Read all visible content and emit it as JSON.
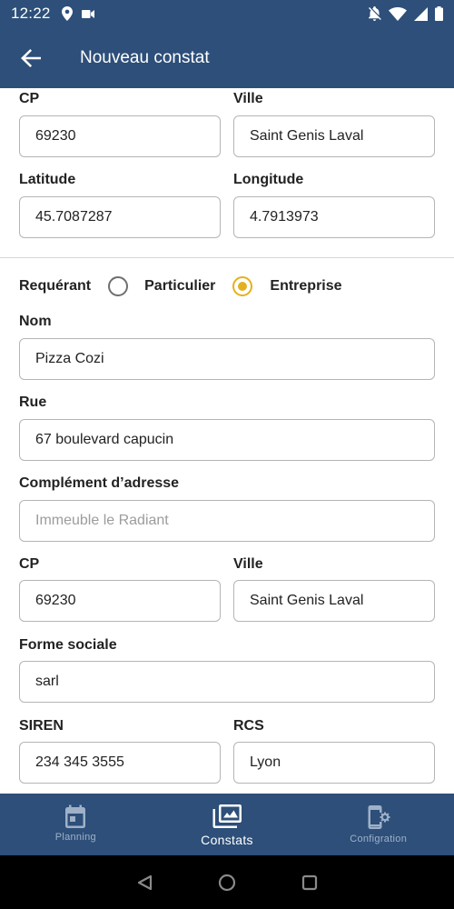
{
  "status_bar": {
    "time": "12:22",
    "left_icons": [
      "location-icon",
      "video-camera-icon"
    ],
    "right_icons": [
      "notifications-off-icon",
      "wifi-icon",
      "signal-icon",
      "battery-icon"
    ]
  },
  "app_bar": {
    "title": "Nouveau constat"
  },
  "location_section": {
    "cp_label": "CP",
    "cp_value": "69230",
    "ville_label": "Ville",
    "ville_value": "Saint Genis Laval",
    "latitude_label": "Latitude",
    "latitude_value": "45.7087287",
    "longitude_label": "Longitude",
    "longitude_value": "4.7913973"
  },
  "requerant": {
    "label": "Requérant",
    "options": [
      {
        "label": "Particulier",
        "selected": false
      },
      {
        "label": "Entreprise",
        "selected": true
      }
    ],
    "accent_color": "#e3b11f"
  },
  "company": {
    "nom_label": "Nom",
    "nom_value": "Pizza Cozi",
    "rue_label": "Rue",
    "rue_value": "67 boulevard capucin",
    "complement_label": "Complément d’adresse",
    "complement_placeholder": "Immeuble le Radiant",
    "cp_label": "CP",
    "cp_value": "69230",
    "ville_label": "Ville",
    "ville_value": "Saint Genis Laval",
    "forme_label": "Forme sociale",
    "forme_value": "sarl",
    "siren_label": "SIREN",
    "siren_value": "234 345 3555",
    "rcs_label": "RCS",
    "rcs_value": "Lyon"
  },
  "bottom_nav": {
    "items": [
      {
        "label": "Planning",
        "icon": "calendar-icon",
        "active": false
      },
      {
        "label": "Constats",
        "icon": "photo-library-icon",
        "active": true
      },
      {
        "label": "Configration",
        "icon": "phone-settings-icon",
        "active": false
      }
    ]
  },
  "colors": {
    "primary": "#2d4f79",
    "accent": "#e3b11f"
  }
}
